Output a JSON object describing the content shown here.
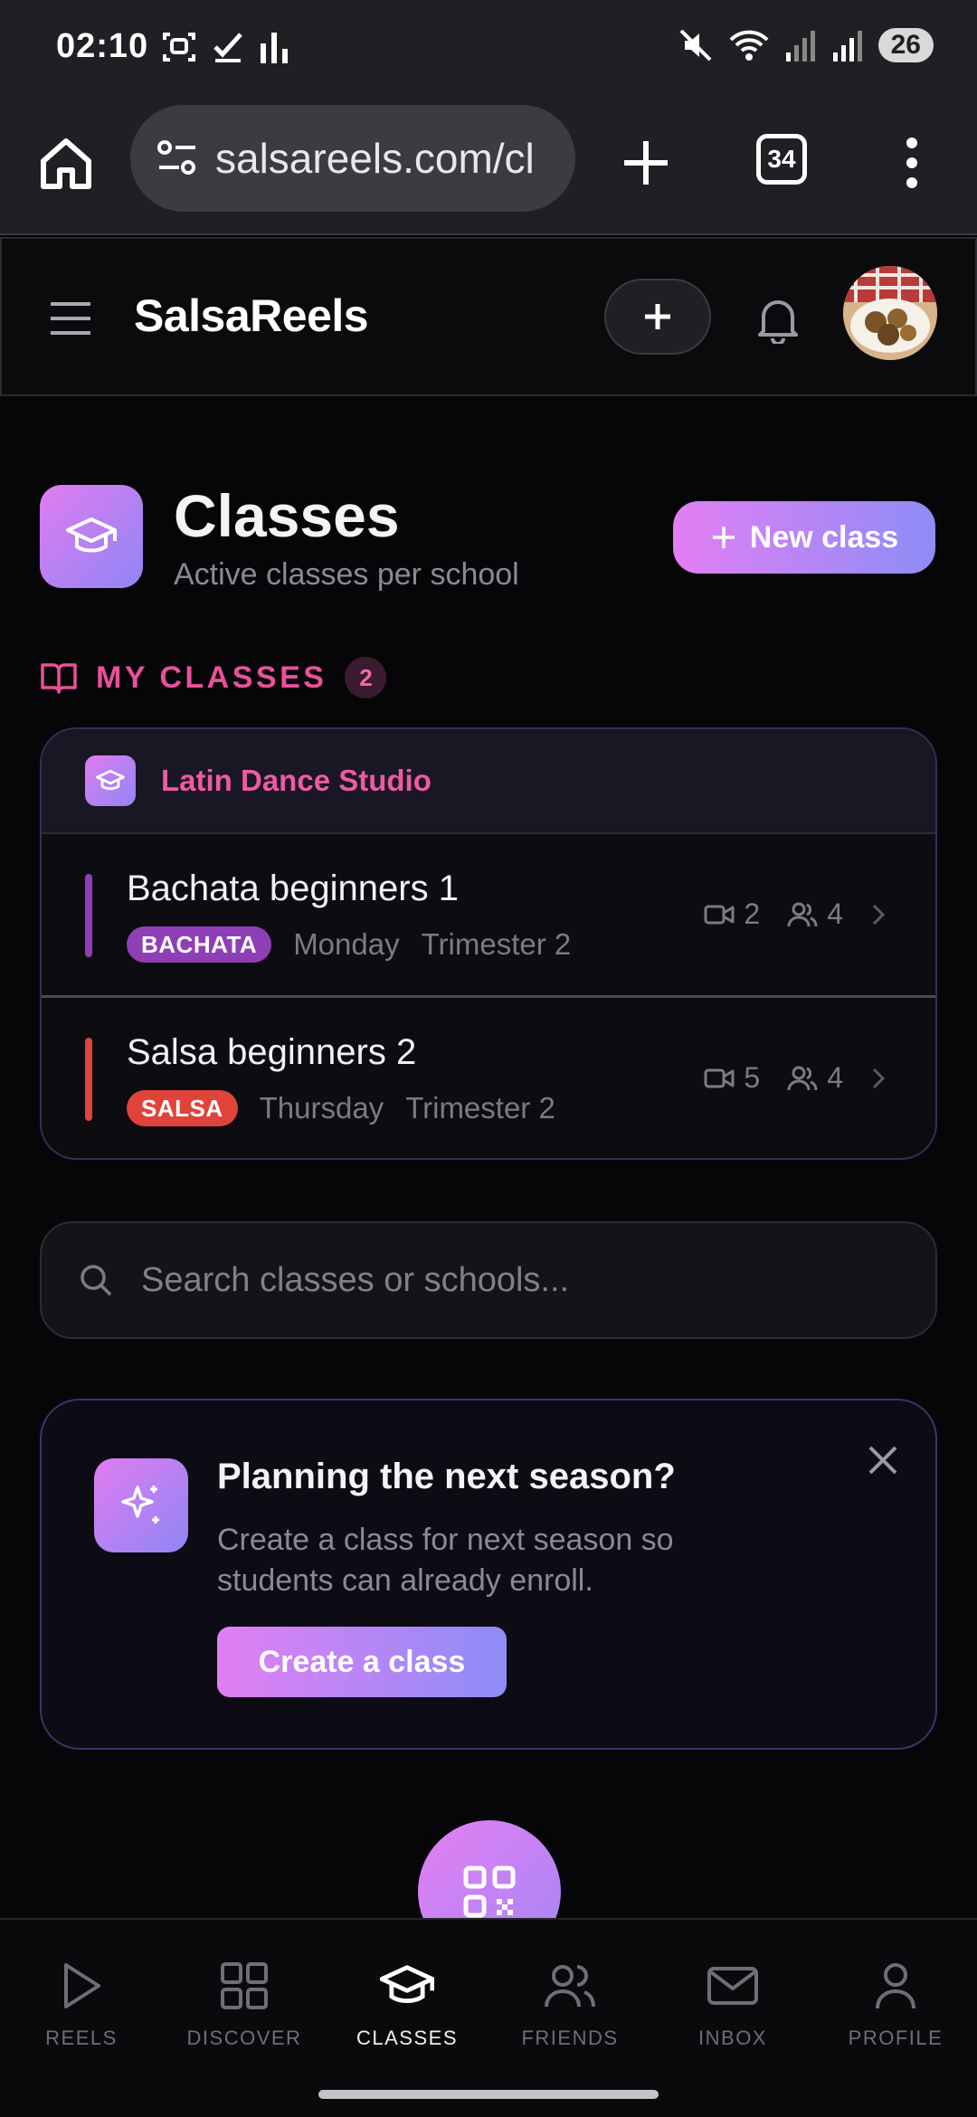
{
  "status_bar": {
    "time": "02:10",
    "battery": "26",
    "icons": [
      "screenshot-icon",
      "check-icon",
      "bars-icon",
      "mute-icon",
      "wifi-icon",
      "signal-icon",
      "signal-icon"
    ]
  },
  "browser": {
    "url": "salsareels.com/cl",
    "tab_count": "34"
  },
  "header": {
    "brand": "SalsaReels"
  },
  "page": {
    "title": "Classes",
    "subtitle": "Active classes per school",
    "new_class_label": "New class"
  },
  "my_classes": {
    "label": "MY CLASSES",
    "count": "2",
    "school": "Latin Dance Studio",
    "classes": [
      {
        "name": "Bachata beginners 1",
        "style": "BACHATA",
        "style_color": "#8e3fb6",
        "day": "Monday",
        "term": "Trimester 2",
        "videos": "2",
        "students": "4"
      },
      {
        "name": "Salsa beginners 2",
        "style": "SALSA",
        "style_color": "#e0433a",
        "day": "Thursday",
        "term": "Trimester 2",
        "videos": "5",
        "students": "4"
      }
    ]
  },
  "search": {
    "placeholder": "Search classes or schools..."
  },
  "promo": {
    "title": "Planning the next season?",
    "body": "Create a class for next season so students can already enroll.",
    "button": "Create a class"
  },
  "nav": {
    "items": [
      {
        "label": "REELS",
        "icon": "play-icon"
      },
      {
        "label": "DISCOVER",
        "icon": "grid-icon"
      },
      {
        "label": "CLASSES",
        "icon": "graduation-cap-icon",
        "active": true
      },
      {
        "label": "FRIENDS",
        "icon": "friends-icon"
      },
      {
        "label": "INBOX",
        "icon": "mail-icon"
      },
      {
        "label": "PROFILE",
        "icon": "user-icon"
      }
    ]
  },
  "colors": {
    "accent_pink": "#e9519b",
    "gradient_start": "#e27ff4",
    "gradient_end": "#8e8cf6"
  }
}
